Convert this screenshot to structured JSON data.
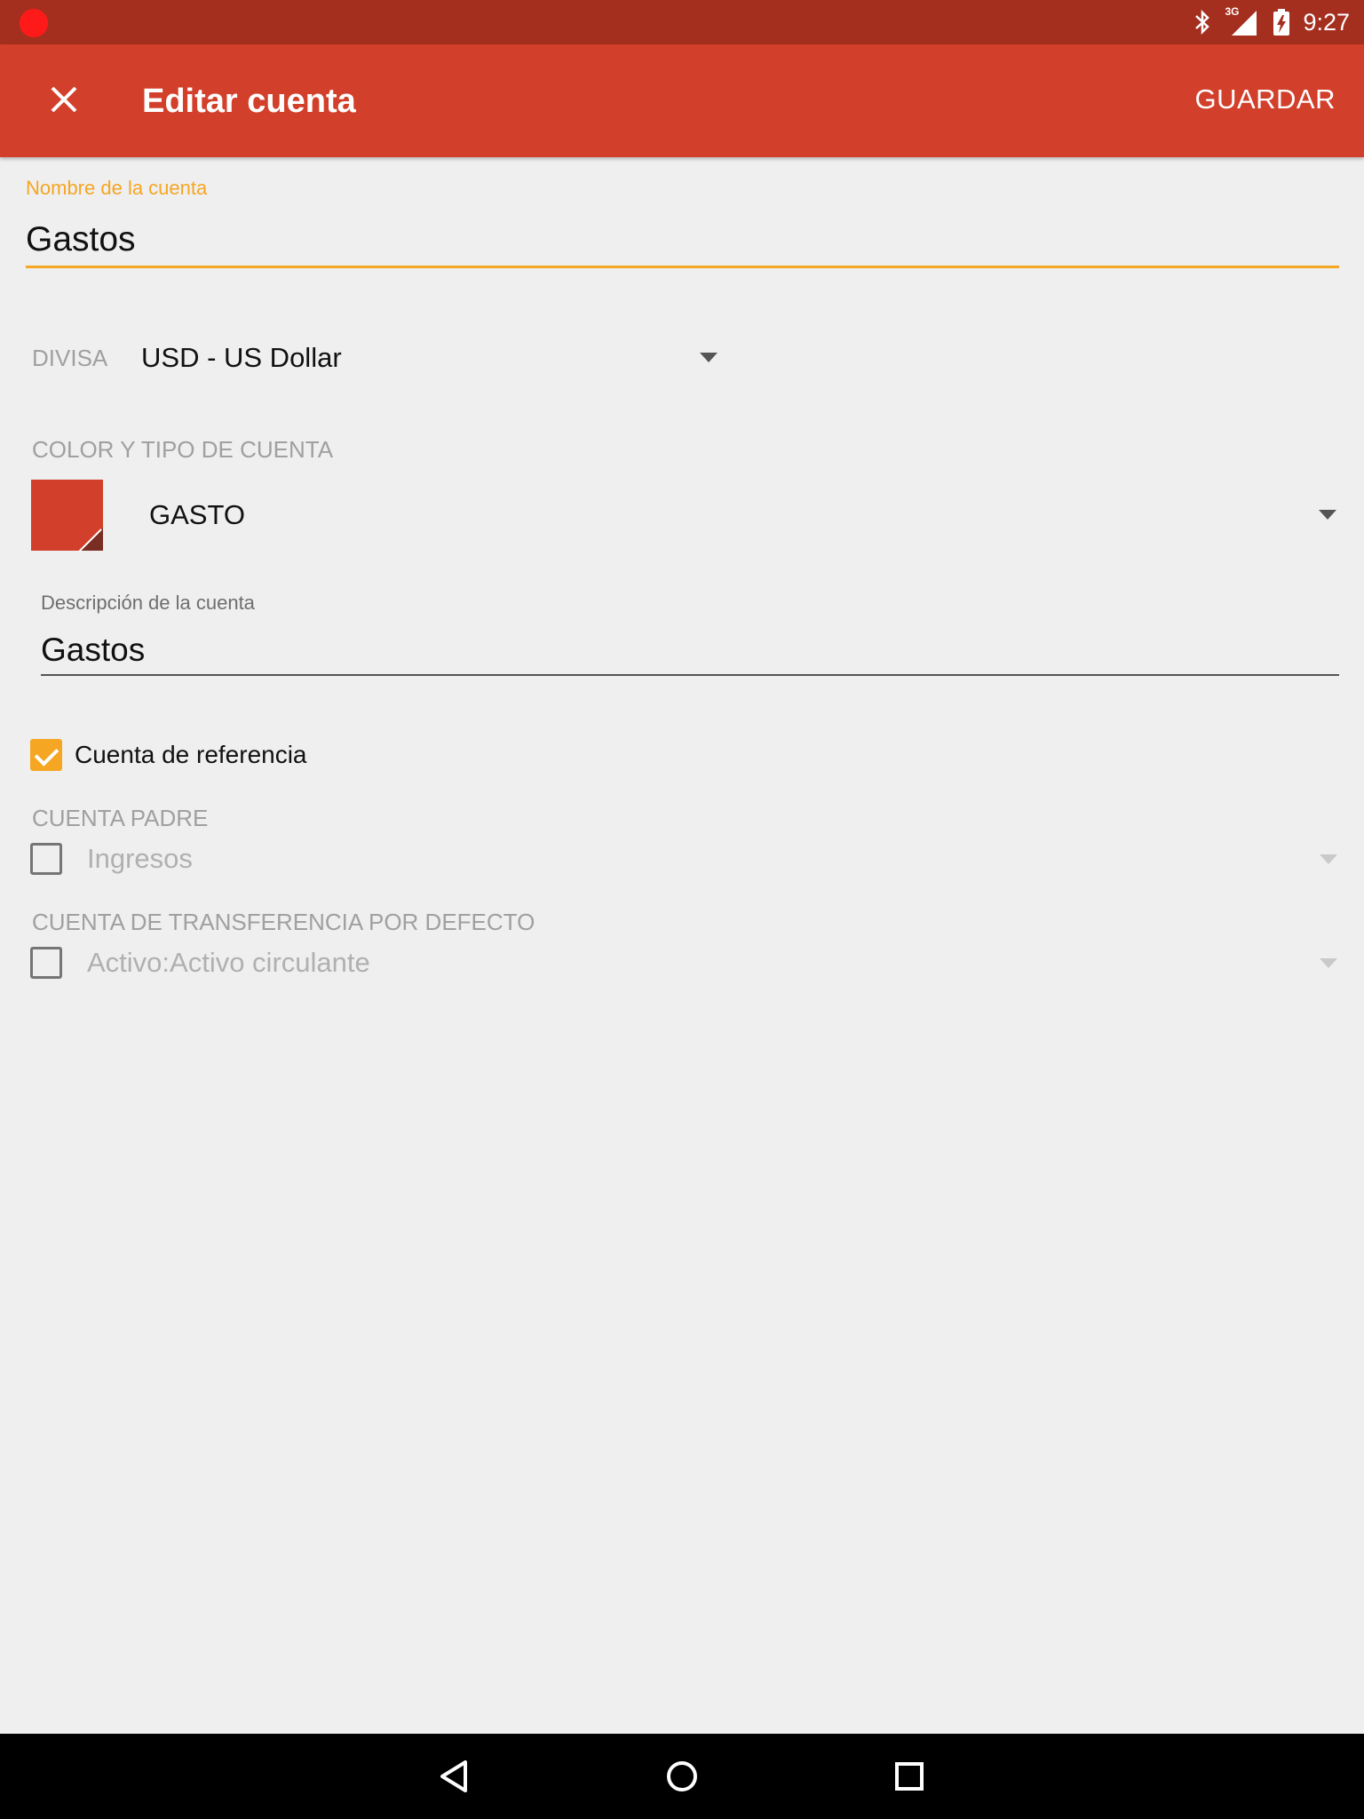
{
  "statusbar": {
    "time": "9:27",
    "network": "3G"
  },
  "appbar": {
    "title": "Editar cuenta",
    "save_label": "GUARDAR"
  },
  "form": {
    "name_label": "Nombre de la cuenta",
    "name_value": "Gastos",
    "currency_label": "DIVISA",
    "currency_value": "USD - US Dollar",
    "color_type_label": "COLOR Y TIPO DE CUENTA",
    "account_type": "GASTO",
    "account_color": "#d23f2a",
    "description_label": "Descripción de la cuenta",
    "description_value": "Gastos",
    "placeholder_label": "Cuenta de referencia",
    "placeholder_checked": true,
    "parent_label": "CUENTA PADRE",
    "parent_value": "Ingresos",
    "parent_checked": false,
    "transfer_label": "CUENTA DE TRANSFERENCIA POR DEFECTO",
    "transfer_value": "Activo:Activo circulante",
    "transfer_checked": false
  },
  "colors": {
    "primary": "#d23f2a",
    "primary_dark": "#a52f1f",
    "accent": "#f5a623"
  },
  "navbar": {
    "icons": [
      "back-icon",
      "home-icon",
      "recents-icon"
    ]
  }
}
